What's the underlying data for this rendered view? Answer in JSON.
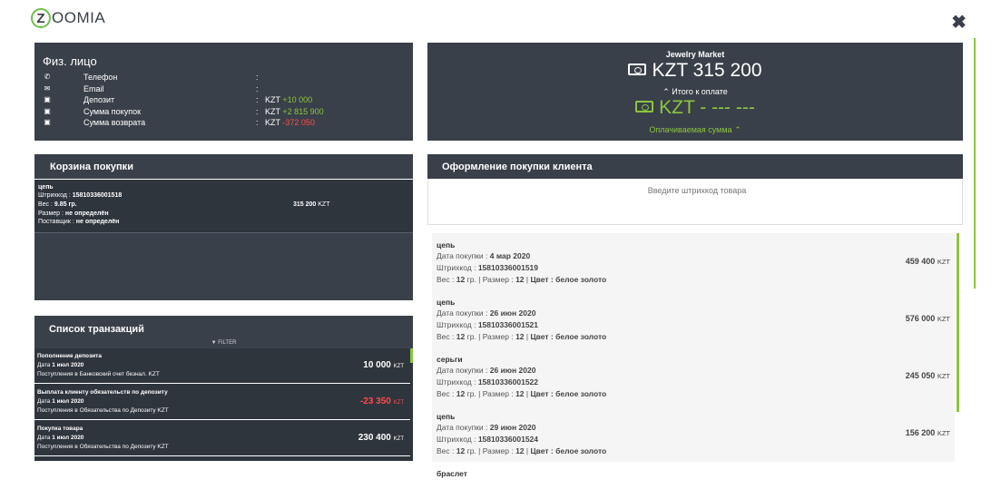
{
  "header": {
    "logo_letter": "Z",
    "logo_rest": "OOMIA",
    "close_icon": "✖"
  },
  "customer": {
    "title": "Физ. лицо",
    "rows": [
      {
        "icon": "phone-icon",
        "glyph": "✆",
        "label": "Телефон",
        "currency": "",
        "value": "",
        "color": ""
      },
      {
        "icon": "envelope-icon",
        "glyph": "✉",
        "label": "Email",
        "currency": "",
        "value": "",
        "color": ""
      },
      {
        "icon": "money-icon",
        "glyph": "▣",
        "label": "Депозит",
        "currency": "KZT",
        "value": "+10 000",
        "color": "#8bc53f"
      },
      {
        "icon": "money-icon",
        "glyph": "▣",
        "label": "Сумма покупок",
        "currency": "KZT",
        "value": "+2 815 900",
        "color": "#8bc53f"
      },
      {
        "icon": "money-icon",
        "glyph": "▣",
        "label": "Сумма возврата",
        "currency": "KZT",
        "value": "-372 050",
        "color": "#ff4a4a"
      }
    ]
  },
  "market": {
    "name": "Jewelry Market",
    "total": "KZT 315 200",
    "total_label": "Итого к оплате",
    "to_pay": "KZT - --- ---",
    "paid_label": "Оплачиваемая сумма"
  },
  "cart": {
    "title": "Корзина покупки",
    "item": {
      "name": "цепь",
      "barcode_label": "Штрихкод :",
      "barcode": "15810336001518",
      "weight_label": "Вес :",
      "weight": "9.85 гр.",
      "size_label": "Размер :",
      "size": "не определён",
      "supplier_label": "Поставщик :",
      "supplier": "не определён",
      "price": "315 200",
      "currency": "KZT"
    }
  },
  "transactions": {
    "title": "Список транзакций",
    "filter": "FILTER",
    "items": [
      {
        "title": "Пополнение депозита",
        "date_label": "Дата",
        "date": "1 июл 2020",
        "note": "Поступления в Банковский счет безнал. KZT",
        "amount": "10 000",
        "currency": "KZT",
        "color": "#ffffff"
      },
      {
        "title": "Выплата клиенту обязательств по депозиту",
        "date_label": "Дата",
        "date": "1 июл 2020",
        "note": "Поступления в Обязательства по Депозиту KZT",
        "amount": "-23 350",
        "currency": "KZT",
        "color": "#ff4a4a"
      },
      {
        "title": "Покупка товара",
        "date_label": "Дата",
        "date": "1 июл 2020",
        "note": "Поступления в Обязательства по Депозиту KZT",
        "amount": "230 400",
        "currency": "KZT",
        "color": "#ffffff"
      }
    ]
  },
  "checkout": {
    "title": "Оформление покупки клиента",
    "barcode_placeholder": "Введите штрихкод товара",
    "products": [
      {
        "name": "цепь",
        "date_label": "Дата покупки :",
        "date": "4 мар 2020",
        "barcode_label": "Штрихкод :",
        "barcode": "15810336001519",
        "weight_label": "Вес :",
        "weight": "12",
        "unit": "гр.",
        "size_label": "Размер :",
        "size": "12",
        "color_label": "Цвет :",
        "color": "белое золото",
        "price": "459 400",
        "currency": "KZT"
      },
      {
        "name": "цепь",
        "date_label": "Дата покупки :",
        "date": "26 июн 2020",
        "barcode_label": "Штрихкод :",
        "barcode": "15810336001521",
        "weight_label": "Вес :",
        "weight": "12",
        "unit": "гр.",
        "size_label": "Размер :",
        "size": "12",
        "color_label": "Цвет :",
        "color": "белое золото",
        "price": "576 000",
        "currency": "KZT"
      },
      {
        "name": "серьги",
        "date_label": "Дата покупки :",
        "date": "26 июн 2020",
        "barcode_label": "Штрихкод :",
        "barcode": "15810336001522",
        "weight_label": "Вес :",
        "weight": "12",
        "unit": "гр.",
        "size_label": "Размер :",
        "size": "12",
        "color_label": "Цвет :",
        "color": "белое золото",
        "price": "245 050",
        "currency": "KZT"
      },
      {
        "name": "цепь",
        "date_label": "Дата покупки :",
        "date": "29 июн 2020",
        "barcode_label": "Штрихкод :",
        "barcode": "15810336001524",
        "weight_label": "Вес :",
        "weight": "12",
        "unit": "гр.",
        "size_label": "Размер :",
        "size": "12",
        "color_label": "Цвет :",
        "color": "белое золото",
        "price": "156 200",
        "currency": "KZT"
      }
    ],
    "partial_item": "браслет"
  },
  "colors": {
    "accent": "#8bc53f",
    "panel": "#3a4049",
    "negative": "#ff4a4a"
  }
}
